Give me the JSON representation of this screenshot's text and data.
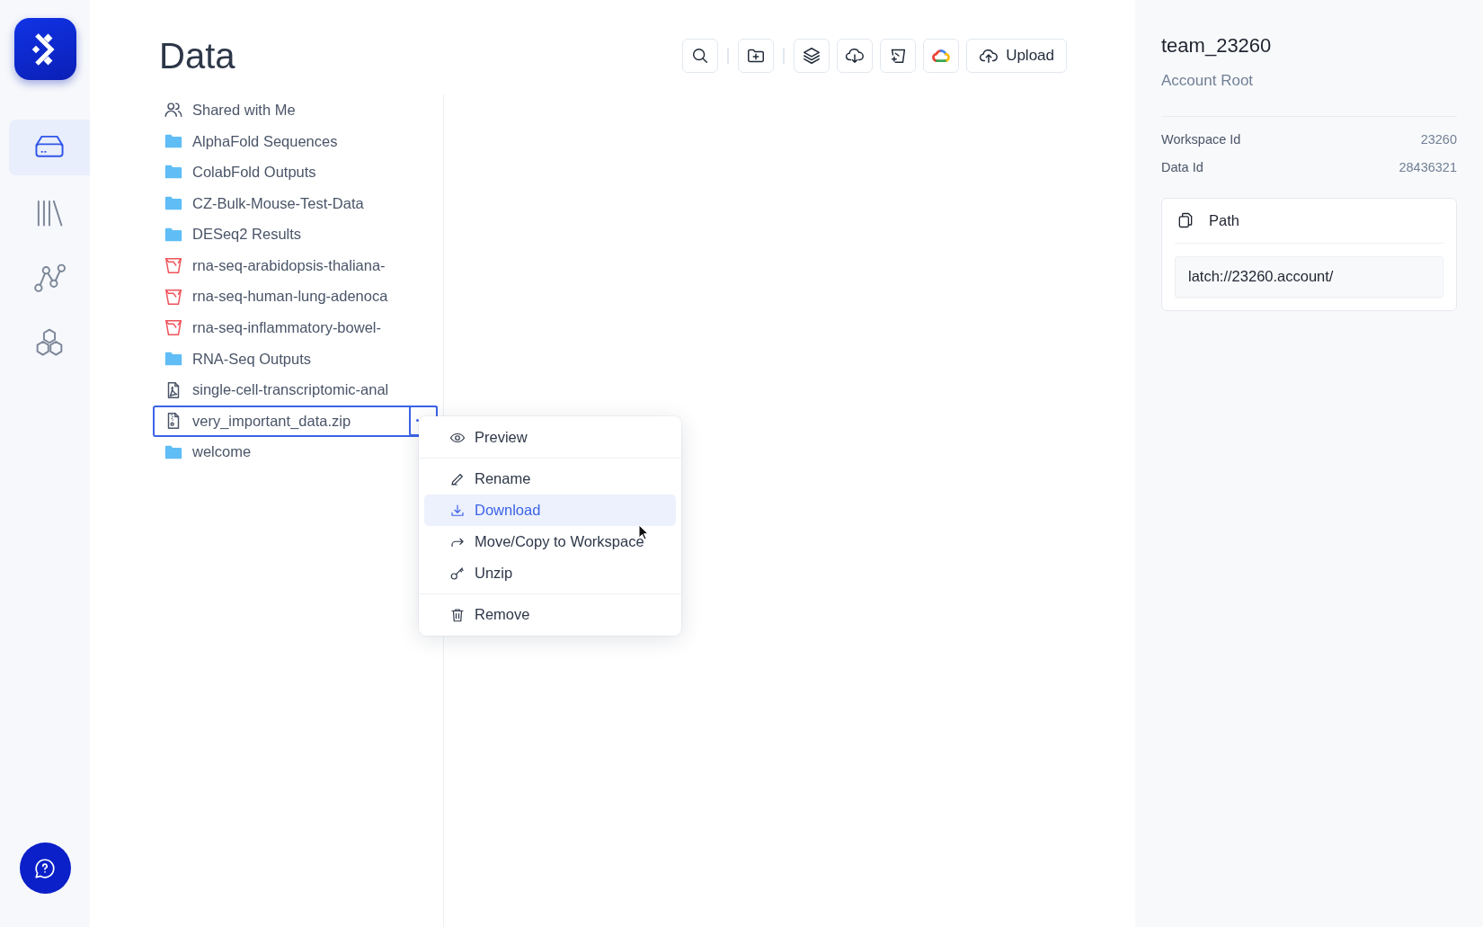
{
  "sidebar": {
    "nav": [
      {
        "selected": true
      },
      {
        "selected": false
      },
      {
        "selected": false
      },
      {
        "selected": false
      }
    ]
  },
  "page": {
    "title": "Data"
  },
  "toolbar": {
    "upload_button": "Upload"
  },
  "files": [
    {
      "name": "Shared with Me",
      "kind": "shared",
      "selected": false
    },
    {
      "name": "AlphaFold Sequences",
      "kind": "folder",
      "selected": false
    },
    {
      "name": "ColabFold Outputs",
      "kind": "folder",
      "selected": false
    },
    {
      "name": "CZ-Bulk-Mouse-Test-Data",
      "kind": "folder",
      "selected": false
    },
    {
      "name": "DESeq2 Results",
      "kind": "folder",
      "selected": false
    },
    {
      "name": "rna-seq-arabidopsis-thaliana-",
      "kind": "bucket",
      "selected": false
    },
    {
      "name": "rna-seq-human-lung-adenoca",
      "kind": "bucket",
      "selected": false
    },
    {
      "name": "rna-seq-inflammatory-bowel-",
      "kind": "bucket",
      "selected": false
    },
    {
      "name": "RNA-Seq Outputs",
      "kind": "folder",
      "selected": false
    },
    {
      "name": "single-cell-transcriptomic-anal",
      "kind": "document",
      "selected": false
    },
    {
      "name": "very_important_data.zip",
      "kind": "archive",
      "selected": true
    },
    {
      "name": "welcome",
      "kind": "folder",
      "selected": false
    }
  ],
  "context_menu": {
    "groups": [
      [
        {
          "label": "Preview",
          "highlighted": false
        }
      ],
      [
        {
          "label": "Rename",
          "highlighted": false
        },
        {
          "label": "Download",
          "highlighted": true
        },
        {
          "label": "Move/Copy to Workspace",
          "highlighted": false
        },
        {
          "label": "Unzip",
          "highlighted": false
        }
      ],
      [
        {
          "label": "Remove",
          "highlighted": false
        }
      ]
    ]
  },
  "details": {
    "title": "team_23260",
    "subtitle": "Account Root",
    "fields": [
      {
        "label": "Workspace Id",
        "value": "23260"
      },
      {
        "label": "Data Id",
        "value": "28436321"
      }
    ],
    "path": {
      "label": "Path",
      "value": "latch://23260.account/"
    }
  }
}
